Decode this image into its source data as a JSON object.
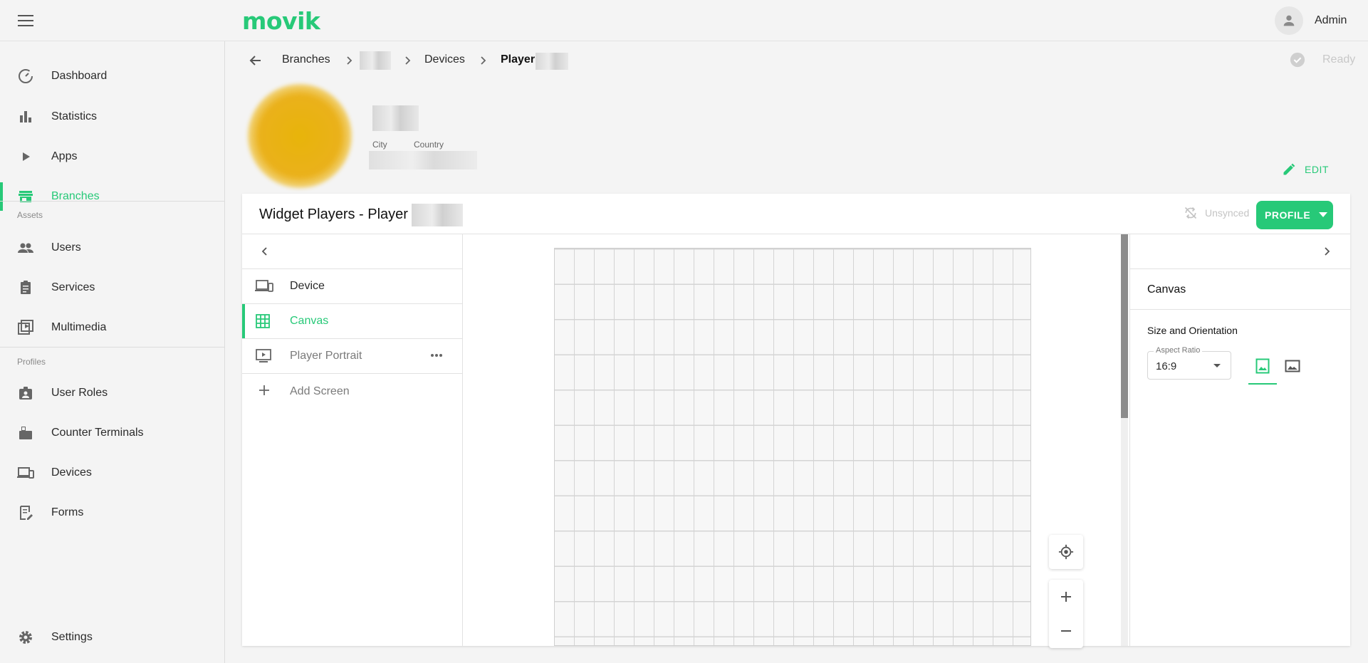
{
  "app": {
    "logo": "movik",
    "user_name": "Admin"
  },
  "colors": {
    "accent": "#27c978",
    "text": "#2a2a2a",
    "muted": "#c8c8c8"
  },
  "sidebar": {
    "items": [
      {
        "label": "Dashboard",
        "icon": "speed-icon"
      },
      {
        "label": "Statistics",
        "icon": "bar-chart-icon"
      },
      {
        "label": "Apps",
        "icon": "play-icon"
      },
      {
        "label": "Branches",
        "icon": "store-icon",
        "active": true
      }
    ],
    "assets_label": "Assets",
    "assets": [
      {
        "label": "Users",
        "icon": "people-icon"
      },
      {
        "label": "Services",
        "icon": "clipboard-icon"
      },
      {
        "label": "Multimedia",
        "icon": "video-library-icon"
      }
    ],
    "profiles_label": "Profiles",
    "profiles": [
      {
        "label": "User Roles",
        "icon": "badge-icon"
      },
      {
        "label": "Counter Terminals",
        "icon": "terminal-icon"
      },
      {
        "label": "Devices",
        "icon": "devices-icon"
      },
      {
        "label": "Forms",
        "icon": "form-icon"
      }
    ],
    "settings_label": "Settings"
  },
  "breadcrumb": {
    "branches": "Branches",
    "devices": "Devices",
    "player": "Player"
  },
  "status": {
    "label": "Ready"
  },
  "branch": {
    "city_label": "City",
    "country_label": "Country",
    "edit_label": "EDIT"
  },
  "card": {
    "title": "Widget Players -  Player",
    "unsynced_label": "Unsynced",
    "profile_button": "PROFILE"
  },
  "screens": [
    {
      "label": "Device",
      "icon": "devices-icon"
    },
    {
      "label": "Canvas",
      "icon": "grid-icon",
      "active": true
    },
    {
      "label": "Player Portrait",
      "icon": "tv-icon"
    },
    {
      "label": "Add Screen",
      "icon": "plus-icon"
    }
  ],
  "props": {
    "title": "Canvas",
    "section": "Size and Orientation",
    "aspect_legend": "Aspect Ratio",
    "aspect_value": "16:9",
    "orientation": "portrait"
  }
}
